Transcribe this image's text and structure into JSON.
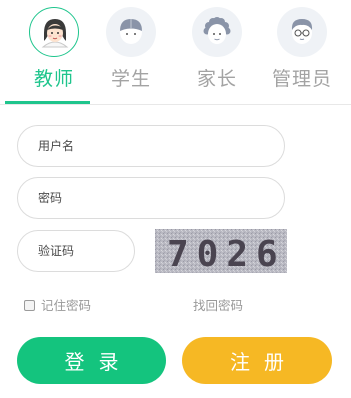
{
  "roles": [
    {
      "label": "教师",
      "icon": "teacher-avatar-icon",
      "active": true
    },
    {
      "label": "学生",
      "icon": "student-avatar-icon",
      "active": false
    },
    {
      "label": "家长",
      "icon": "parent-avatar-icon",
      "active": false
    },
    {
      "label": "管理员",
      "icon": "admin-avatar-icon",
      "active": false
    }
  ],
  "form": {
    "username_placeholder": "用户名",
    "password_placeholder": "密码",
    "captcha_placeholder": "验证码",
    "captcha_text": "7026"
  },
  "options": {
    "remember_label": "记住密码",
    "remember_checked": false,
    "forgot_label": "找回密码"
  },
  "buttons": {
    "login": "登录",
    "register": "注册"
  },
  "colors": {
    "accent_green": "#1fc58d",
    "login_green": "#14c47e",
    "register_yellow": "#f6b824"
  }
}
